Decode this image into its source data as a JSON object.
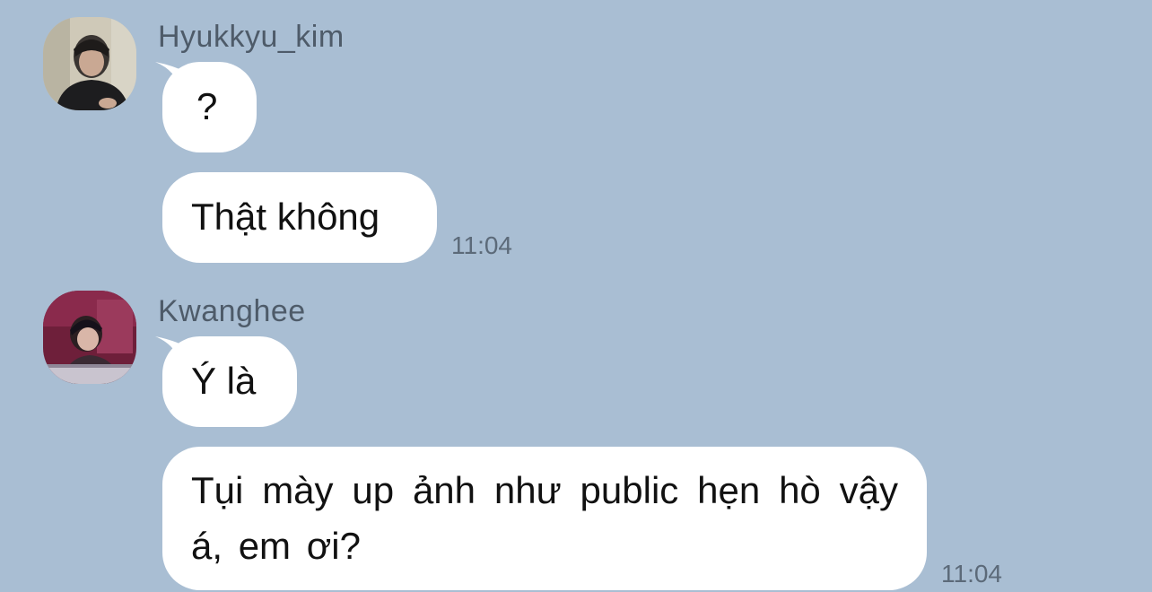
{
  "colors": {
    "background": "#a9bed3",
    "bubble": "#ffffff",
    "sender_name": "#4e5b69",
    "timestamp": "#5c6a79"
  },
  "groups": [
    {
      "sender": "Hyukkyu_kim",
      "avatar": "profile-photo",
      "messages": [
        {
          "text": "?"
        },
        {
          "text": "Thật không"
        }
      ],
      "time": "11:04"
    },
    {
      "sender": "Kwanghee",
      "avatar": "profile-photo",
      "messages": [
        {
          "text": "Ý là"
        },
        {
          "text": "Tụi mày up ảnh như public hẹn hò vậy á, em ơi?"
        }
      ],
      "time": "11:04"
    }
  ]
}
